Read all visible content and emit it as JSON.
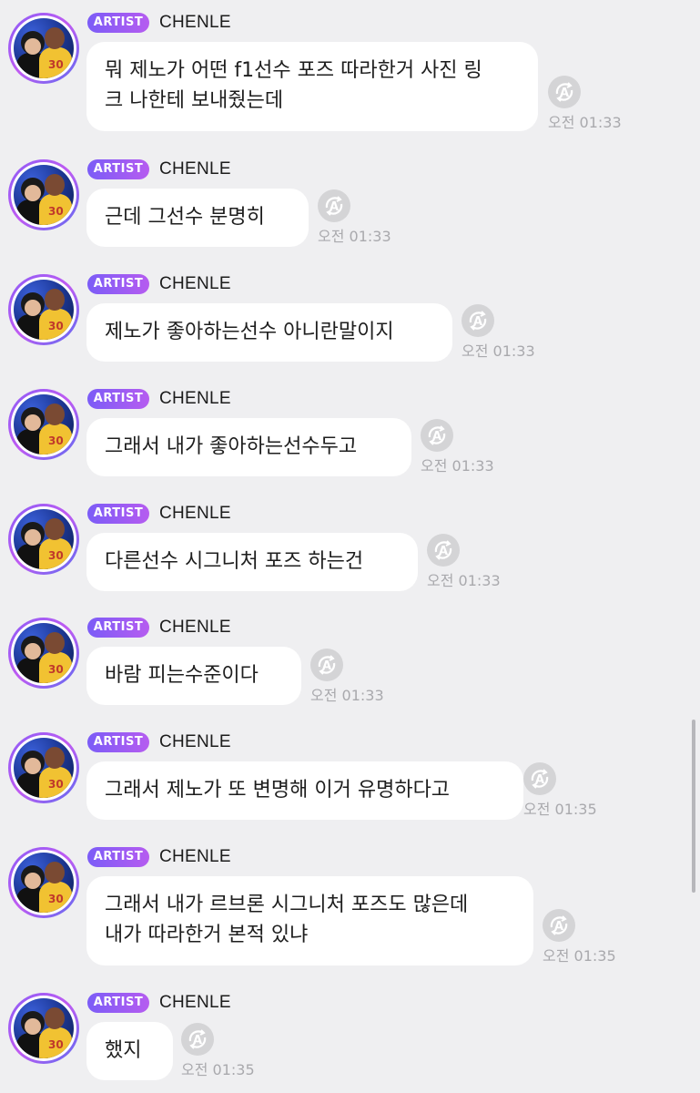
{
  "badge_label": "ARTIST",
  "artist_name": "CHENLE",
  "messages": [
    {
      "text": "뭐 제노가 어떤 f1선수 포즈 따라한거 사진 링\n크 나한테 보내줬는데",
      "time": "오전 01:33"
    },
    {
      "text": "근데 그선수 분명히",
      "time": "오전 01:33"
    },
    {
      "text": "제노가 좋아하는선수 아니란말이지",
      "time": "오전 01:33"
    },
    {
      "text": "그래서 내가 좋아하는선수두고",
      "time": "오전 01:33"
    },
    {
      "text": "다른선수 시그니처 포즈 하는건",
      "time": "오전 01:33"
    },
    {
      "text": "바람 피는수준이다",
      "time": "오전 01:33"
    },
    {
      "text": "그래서 제노가 또 변명해 이거 유명하다고",
      "time": "오전 01:35"
    },
    {
      "text": "그래서 내가 르브론 시그니처 포즈도 많은데\n내가 따라한거 본적 있냐",
      "time": "오전 01:35"
    },
    {
      "text": "했지",
      "time": "오전 01:35"
    }
  ],
  "colors": {
    "background": "#efeff1",
    "badge_gradient_start": "#7b5cf7",
    "badge_gradient_end": "#b65cf0",
    "bubble": "#ffffff",
    "timestamp": "#a9a9ad"
  },
  "icons": {
    "translate_button": "translate-icon"
  }
}
